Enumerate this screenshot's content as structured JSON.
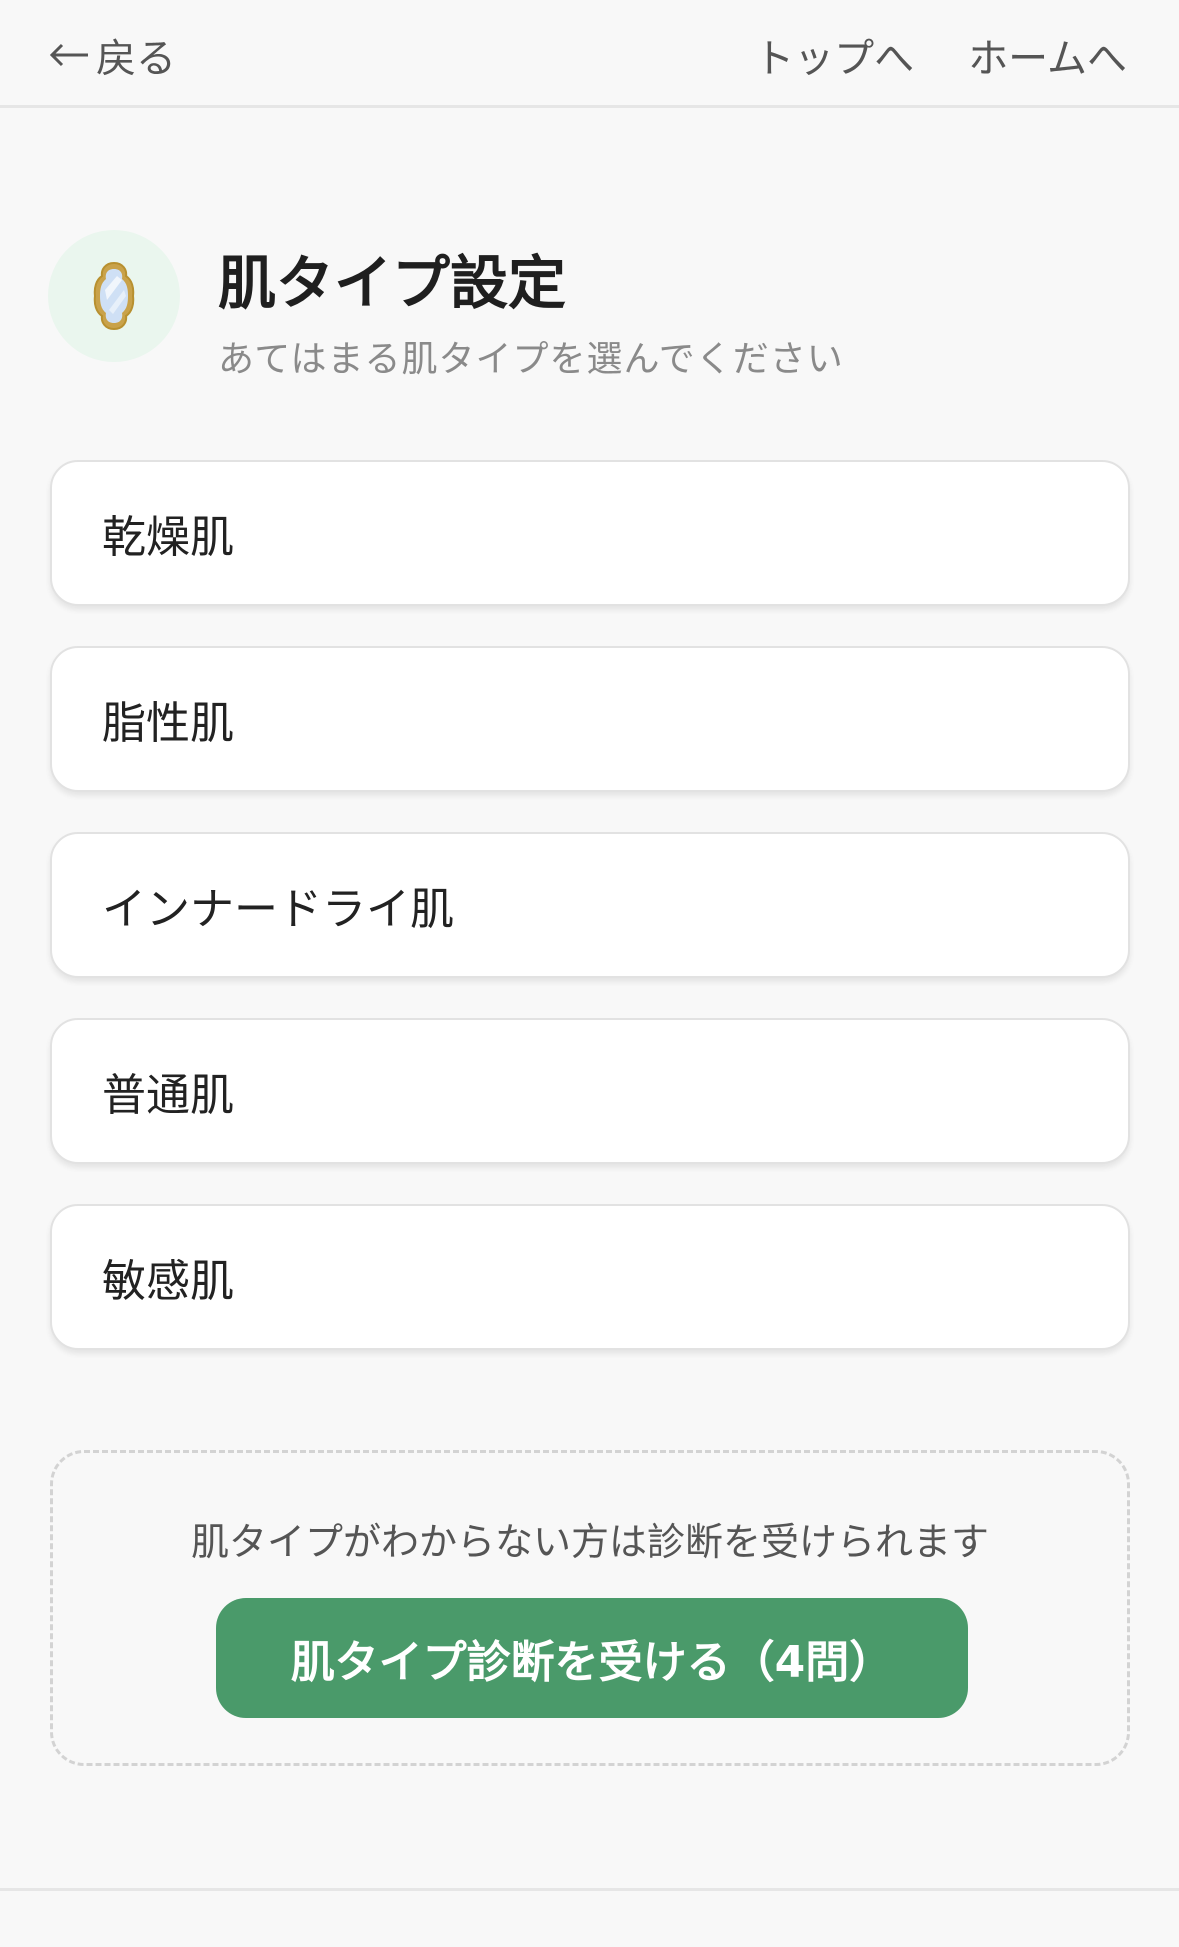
{
  "header": {
    "back_label": "戻る",
    "top_link": "トップへ",
    "home_link": "ホームへ"
  },
  "page": {
    "icon": "mirror-icon",
    "title": "肌タイプ設定",
    "subtitle": "あてはまる肌タイプを選んでください"
  },
  "skin_types": [
    {
      "label": "乾燥肌"
    },
    {
      "label": "脂性肌"
    },
    {
      "label": "インナードライ肌"
    },
    {
      "label": "普通肌"
    },
    {
      "label": "敏感肌"
    }
  ],
  "diagnosis": {
    "note": "肌タイプがわからない方は診断を受けられます",
    "button_label": "肌タイプ診断を受ける（4問）"
  },
  "colors": {
    "accent_green": "#4a9a6a",
    "badge_bg": "#eaf6ee",
    "background": "#f8f8f8"
  }
}
